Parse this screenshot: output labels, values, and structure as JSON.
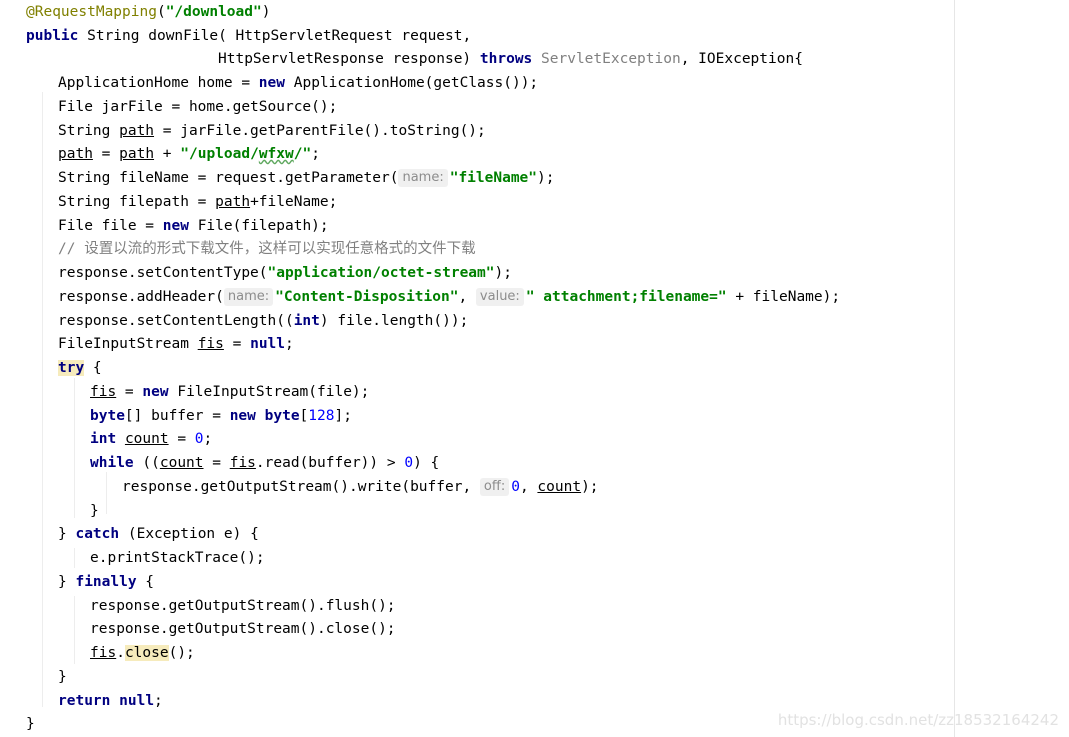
{
  "code": {
    "l01": {
      "ann": "@RequestMapping",
      "p1": "(",
      "s": "\"/download\"",
      "p2": ")"
    },
    "l02": {
      "kw": "public",
      "t": " String downFile( HttpServletRequest request,"
    },
    "l03": {
      "t": "HttpServletResponse response) ",
      "kw": "throws",
      "sp": " ",
      "dep": "ServletException",
      "t2": ", IOException{"
    },
    "l04": {
      "a": "ApplicationHome home = ",
      "kw": "new",
      "b": " ApplicationHome(getClass());"
    },
    "l05": {
      "t": "File jarFile = home.getSource();"
    },
    "l06": {
      "a": "String ",
      "v": "path",
      "b": " = jarFile.getParentFile().toString();"
    },
    "l07": {
      "v1": "path",
      "a": " = ",
      "v2": "path",
      "b": " + ",
      "s1": "\"/upload/",
      "typo": "wfxw",
      "s2": "/\"",
      "c": ";"
    },
    "l08": {
      "a": "String fileName = request.getParameter(",
      "h": "name:",
      "s": "\"fileName\"",
      "b": ");"
    },
    "l09": {
      "a": "String filepath = ",
      "v": "path",
      "b": "+fileName;"
    },
    "l10": {
      "a": "File file = ",
      "kw": "new",
      "b": " File(filepath);"
    },
    "l11": {
      "cmt": "// 设置以流的形式下载文件，这样可以实现任意格式的文件下载"
    },
    "l12": {
      "a": "response.setContentType(",
      "s": "\"application/octet-stream\"",
      "b": ");"
    },
    "l13": {
      "a": "response.addHeader(",
      "h1": "name:",
      "s1": "\"Content-Disposition\"",
      "c": ", ",
      "h2": "value:",
      "s2": "\" attachment;filename=\"",
      "b": " + fileName);"
    },
    "l14": {
      "a": "response.setContentLength((",
      "kw": "int",
      "b": ") file.length());"
    },
    "l15": {
      "a": "FileInputStream ",
      "v": "fis",
      "b": " = ",
      "kw": "null",
      "c": ";"
    },
    "l16": {
      "kw": "try",
      "b": " {"
    },
    "l17": {
      "v": "fis",
      "a": " = ",
      "kw": "new",
      "b": " FileInputStream(file);"
    },
    "l18": {
      "kw1": "byte",
      "a": "[] buffer = ",
      "kw2": "new",
      "sp": " ",
      "kw3": "byte",
      "b": "[",
      "n": "128",
      "c": "];"
    },
    "l19": {
      "kw": "int",
      "sp": " ",
      "v": "count",
      "a": " = ",
      "n": "0",
      "b": ";"
    },
    "l20": {
      "kw": "while",
      "a": " ((",
      "v1": "count",
      "b": " = ",
      "v2": "fis",
      "c": ".read(buffer)) > ",
      "n": "0",
      "d": ") {"
    },
    "l21": {
      "a": "response.getOutputStream().write(buffer, ",
      "h": "off:",
      "n": "0",
      "b": ", ",
      "v": "count",
      "c": ");"
    },
    "l22": {
      "t": "}"
    },
    "l23": {
      "a": "} ",
      "kw": "catch",
      "b": " (Exception e) {"
    },
    "l24": {
      "t": "e.printStackTrace();"
    },
    "l25": {
      "a": "} ",
      "kw": "finally",
      "b": " {"
    },
    "l26": {
      "t": "response.getOutputStream().flush();"
    },
    "l27": {
      "t": "response.getOutputStream().close();"
    },
    "l28": {
      "v": "fis",
      "a": ".",
      "m": "close",
      "b": "();"
    },
    "l29": {
      "t": "}"
    },
    "l30": {
      "kw1": "return",
      "sp": " ",
      "kw2": "null",
      "b": ";"
    },
    "l31": {
      "t": "}"
    }
  },
  "watermark": "https://blog.csdn.net/zz18532164242",
  "colors": {
    "keyword": "#000080",
    "string": "#008000",
    "number": "#0000ff",
    "annotation": "#808000",
    "comment": "#808080",
    "hint_background": "#f0f0f0",
    "brace_match": "#f6ebbc"
  }
}
